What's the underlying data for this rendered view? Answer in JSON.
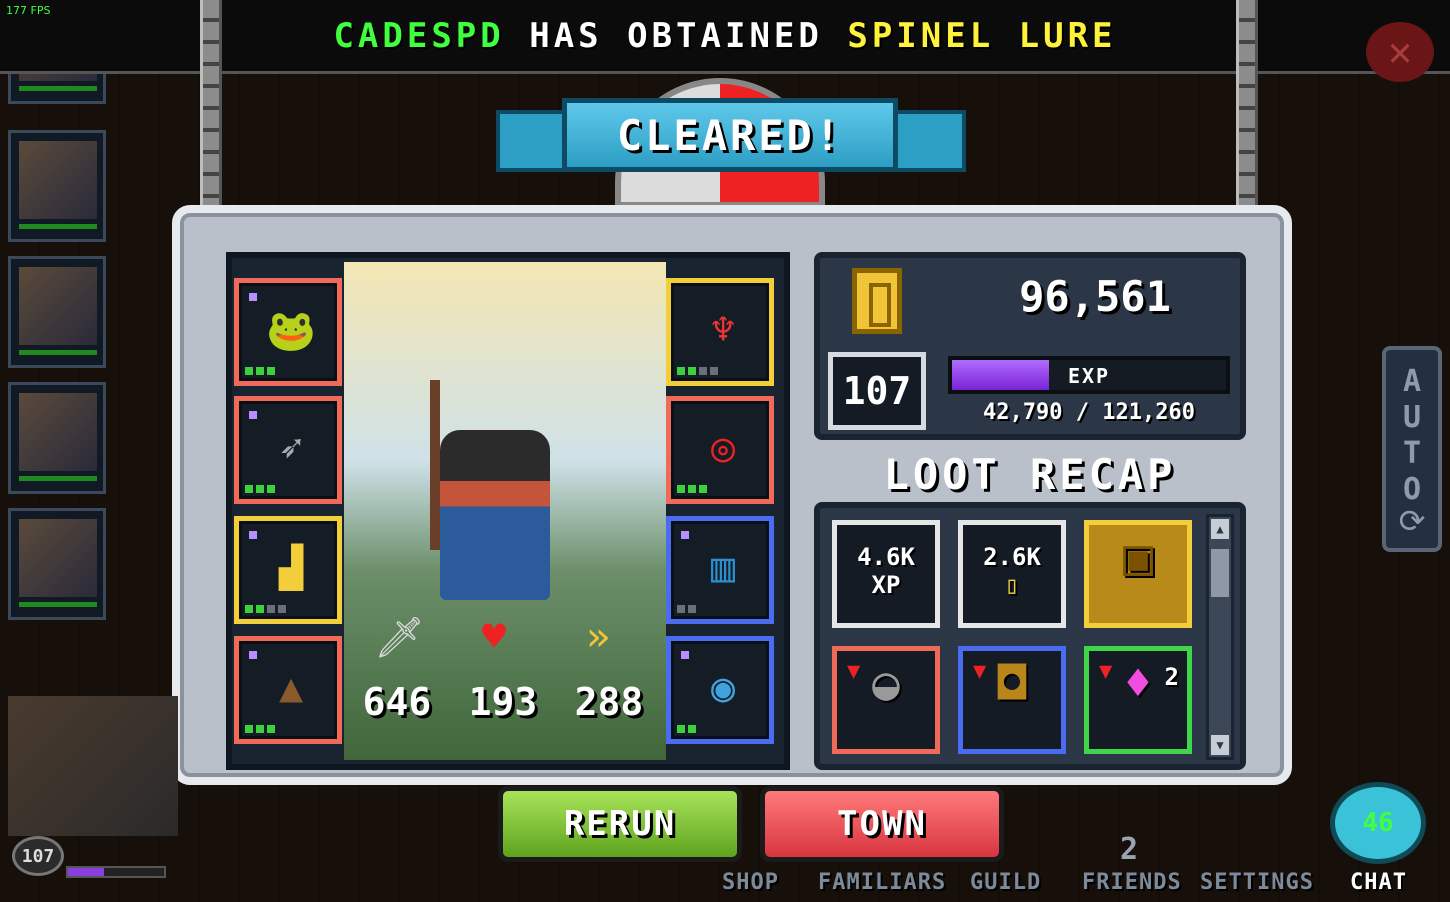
{
  "hud": {
    "fps": "177 FPS"
  },
  "notification": {
    "player": "CADESPD",
    "middle": "HAS OBTAINED",
    "item": "SPINEL LURE"
  },
  "banner": {
    "title": "CLEARED!"
  },
  "stats": {
    "attack": "646",
    "health": "193",
    "speed": "288"
  },
  "currency": {
    "gold": "96,561"
  },
  "level": {
    "value": "107",
    "exp_label": "EXP",
    "exp_current": "42,790",
    "exp_sep": "/",
    "exp_max": "121,260",
    "exp_fraction": 0.353
  },
  "loot": {
    "title": "LOOT RECAP",
    "items": [
      {
        "line1": "4.6K",
        "line2": "XP"
      },
      {
        "line1": "2.6K",
        "line2": ""
      },
      {
        "line1": "",
        "line2": ""
      },
      {
        "line1": "",
        "line2": ""
      },
      {
        "line1": "",
        "line2": ""
      },
      {
        "line1": "",
        "line2": "",
        "count": "2"
      }
    ]
  },
  "buttons": {
    "rerun": "RERUN",
    "town": "TOWN"
  },
  "side": {
    "auto_letters": "AUTO"
  },
  "nav": {
    "shop": "SHOP",
    "familiars": "FAMILIARS",
    "guild": "GUILD",
    "friends": "FRIENDS",
    "friends_count": "2",
    "settings": "SETTINGS",
    "chat": "CHAT",
    "chat_count": "46"
  },
  "self": {
    "level": "107"
  },
  "colors": {
    "player_name": "#3fff3f",
    "item_name": "#fff23a",
    "exp_purple": "#7a22d6",
    "rerun_green": "#5fa31e",
    "town_red": "#d8353f"
  }
}
